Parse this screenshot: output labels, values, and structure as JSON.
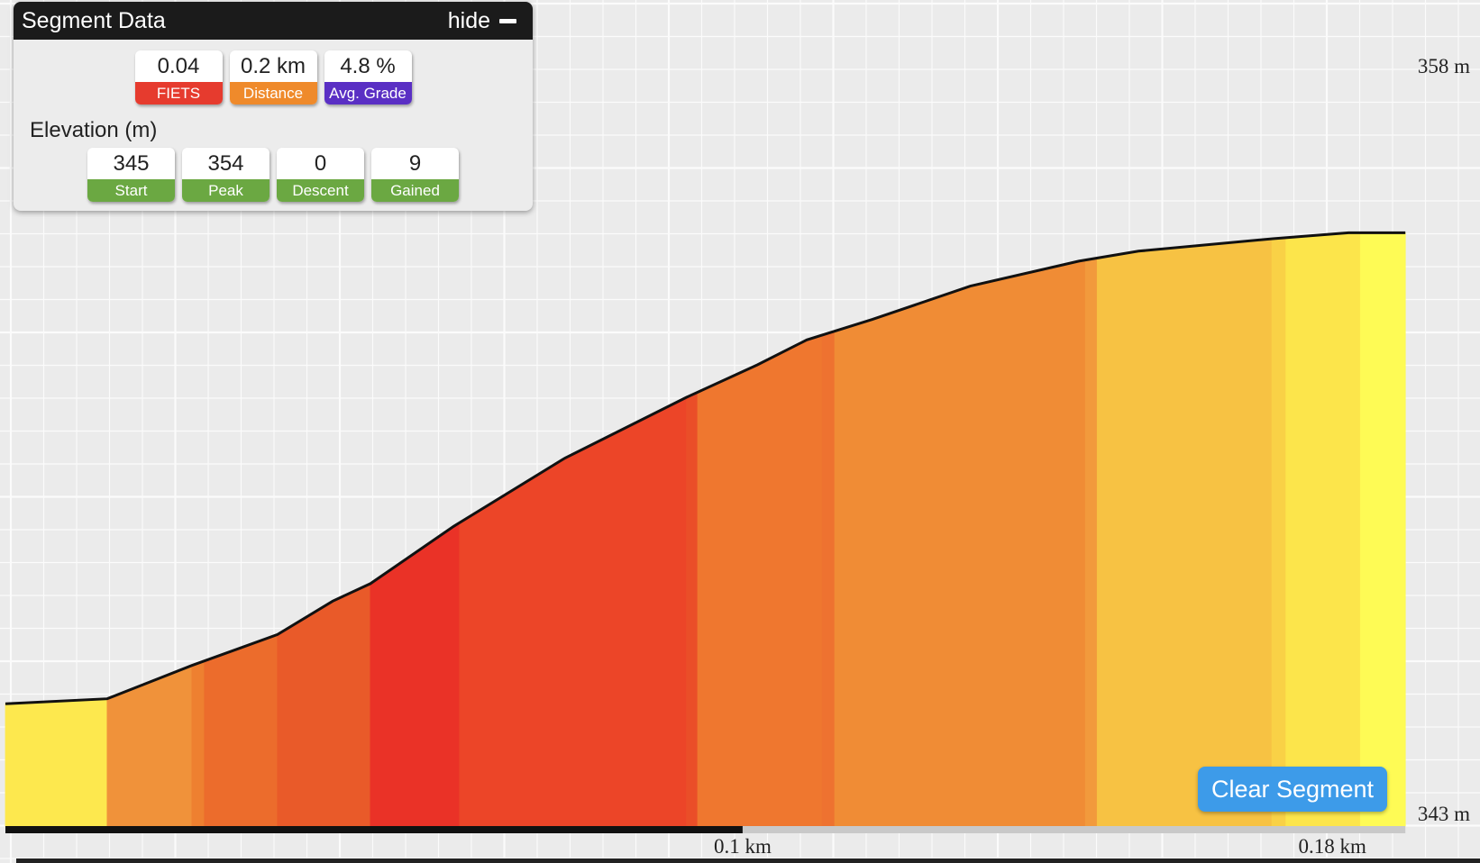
{
  "panel": {
    "title": "Segment Data",
    "hide_label": "hide",
    "elevation_heading": "Elevation (m)",
    "stats": [
      {
        "value": "0.04",
        "label": "FIETS",
        "color": "#e63b2e"
      },
      {
        "value": "0.2 km",
        "label": "Distance",
        "color": "#ef8a2b"
      },
      {
        "value": "4.8 %",
        "label": "Avg. Grade",
        "color": "#5a2fc4"
      }
    ],
    "elevation": [
      {
        "value": "345",
        "label": "Start",
        "color": "#6ba842"
      },
      {
        "value": "354",
        "label": "Peak",
        "color": "#6ba842"
      },
      {
        "value": "0",
        "label": "Descent",
        "color": "#6ba842"
      },
      {
        "value": "9",
        "label": "Gained",
        "color": "#6ba842"
      }
    ]
  },
  "clear_button": "Clear Segment",
  "chart_data": {
    "type": "area",
    "title": "",
    "xlabel": "",
    "ylabel": "",
    "xlim": [
      0,
      0.19
    ],
    "ylim": [
      343,
      358
    ],
    "y_ticks": [
      {
        "value": 358,
        "label": "358 m"
      },
      {
        "value": 343,
        "label": "343 m"
      }
    ],
    "x_ticks": [
      {
        "value": 0.1,
        "label": "0.1 km"
      },
      {
        "value": 0.18,
        "label": "0.18 km"
      }
    ],
    "progress_km": 0.1,
    "grid": true,
    "profile": {
      "x": [
        0.0,
        0.0138,
        0.0253,
        0.0369,
        0.0444,
        0.0495,
        0.0608,
        0.0759,
        0.0924,
        0.102,
        0.1087,
        0.1176,
        0.1309,
        0.1456,
        0.1537,
        0.1719,
        0.1822,
        0.1899
      ],
      "y": [
        345.2,
        345.3,
        345.97,
        346.59,
        347.26,
        347.61,
        348.76,
        350.13,
        351.35,
        352.0,
        352.5,
        352.91,
        353.58,
        354.08,
        354.28,
        354.53,
        354.65,
        354.65
      ]
    },
    "bands": [
      {
        "x": [
          0.0,
          0.0138
        ],
        "color": "#fde84e"
      },
      {
        "x": [
          0.0138,
          0.0253
        ],
        "color": "#f0923a"
      },
      {
        "x": [
          0.0253,
          0.027
        ],
        "color": "#ee8030"
      },
      {
        "x": [
          0.027,
          0.0369
        ],
        "color": "#ec6c2c"
      },
      {
        "x": [
          0.0369,
          0.0495
        ],
        "color": "#e95a29"
      },
      {
        "x": [
          0.0495,
          0.0616
        ],
        "color": "#ea3227"
      },
      {
        "x": [
          0.0616,
          0.0924
        ],
        "color": "#ec4528"
      },
      {
        "x": [
          0.0924,
          0.0939
        ],
        "color": "#ea4e28"
      },
      {
        "x": [
          0.0939,
          0.1108
        ],
        "color": "#ef772f"
      },
      {
        "x": [
          0.1108,
          0.1125
        ],
        "color": "#ee7230"
      },
      {
        "x": [
          0.1125,
          0.1465
        ],
        "color": "#f08c35"
      },
      {
        "x": [
          0.1465,
          0.1481
        ],
        "color": "#f29a3c"
      },
      {
        "x": [
          0.1481,
          0.1718
        ],
        "color": "#f7c243"
      },
      {
        "x": [
          0.1718,
          0.1737
        ],
        "color": "#f9d146"
      },
      {
        "x": [
          0.1737,
          0.1838
        ],
        "color": "#fce54b"
      },
      {
        "x": [
          0.1838,
          0.1899
        ],
        "color": "#fefb55"
      }
    ]
  }
}
